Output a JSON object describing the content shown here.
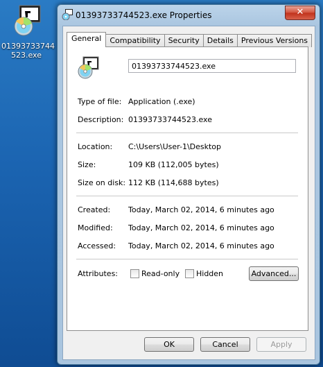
{
  "desktop": {
    "icon_label_line1": "01393733744",
    "icon_label_line2": "523.exe"
  },
  "window": {
    "title": "01393733744523.exe Properties",
    "close_label": "✕"
  },
  "tabs": [
    {
      "label": "General",
      "active": true
    },
    {
      "label": "Compatibility",
      "active": false
    },
    {
      "label": "Security",
      "active": false
    },
    {
      "label": "Details",
      "active": false
    },
    {
      "label": "Previous Versions",
      "active": false
    }
  ],
  "general": {
    "file_name": "01393733744523.exe",
    "type_label": "Type of file:",
    "type_value": "Application (.exe)",
    "description_label": "Description:",
    "description_value": "01393733744523.exe",
    "location_label": "Location:",
    "location_value": "C:\\Users\\User-1\\Desktop",
    "size_label": "Size:",
    "size_value": "109 KB (112,005 bytes)",
    "size_on_disk_label": "Size on disk:",
    "size_on_disk_value": "112 KB (114,688 bytes)",
    "created_label": "Created:",
    "created_value": "Today, March 02, 2014, 6 minutes ago",
    "modified_label": "Modified:",
    "modified_value": "Today, March 02, 2014, 6 minutes ago",
    "accessed_label": "Accessed:",
    "accessed_value": "Today, March 02, 2014, 6 minutes ago",
    "attributes_label": "Attributes:",
    "readonly_label": "Read-only",
    "hidden_label": "Hidden",
    "advanced_label": "Advanced..."
  },
  "footer": {
    "ok_label": "OK",
    "cancel_label": "Cancel",
    "apply_label": "Apply"
  }
}
